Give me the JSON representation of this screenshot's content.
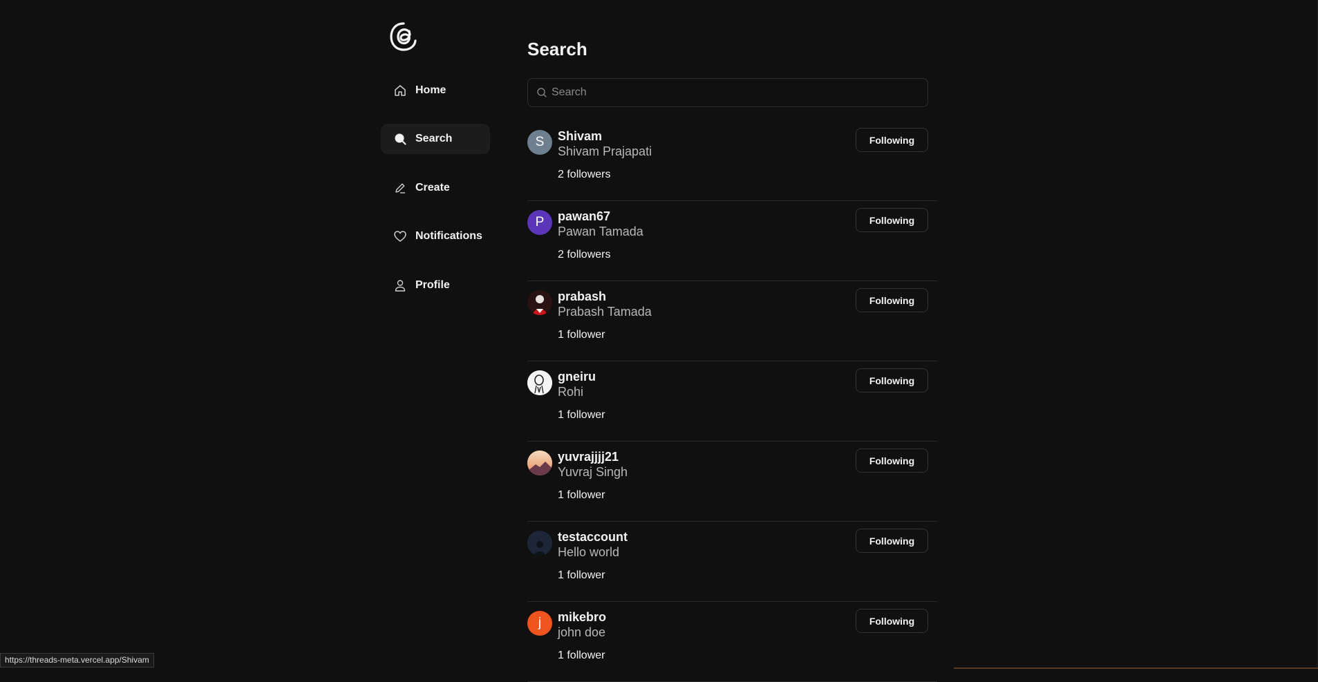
{
  "status_bar": {
    "url": "https://threads-meta.vercel.app/Shivam"
  },
  "sidebar": {
    "logo_icon": "threads-logo",
    "items": [
      {
        "label": "Home",
        "icon": "home-icon",
        "active": false
      },
      {
        "label": "Search",
        "icon": "search-icon",
        "active": true
      },
      {
        "label": "Create",
        "icon": "pencil-icon",
        "active": false
      },
      {
        "label": "Notifications",
        "icon": "heart-icon",
        "active": false
      },
      {
        "label": "Profile",
        "icon": "user-icon",
        "active": false
      }
    ]
  },
  "main": {
    "title": "Search",
    "search": {
      "placeholder": "Search",
      "value": ""
    },
    "users": [
      {
        "username": "Shivam",
        "name": "Shivam Prajapati",
        "followers": "2 followers",
        "button": "Following",
        "avatar_letter": "S",
        "avatar_color": "#6e7f8f"
      },
      {
        "username": "pawan67",
        "name": "Pawan Tamada",
        "followers": "2 followers",
        "button": "Following",
        "avatar_letter": "P",
        "avatar_color": "#5b36b8"
      },
      {
        "username": "prabash",
        "name": "Prabash Tamada",
        "followers": "1 follower",
        "button": "Following",
        "avatar_letter": "",
        "avatar_color": "#2a1212"
      },
      {
        "username": "gneiru",
        "name": "Rohi",
        "followers": "1 follower",
        "button": "Following",
        "avatar_letter": "",
        "avatar_color": "#f2f2f2"
      },
      {
        "username": "yuvrajjjj21",
        "name": "Yuvraj Singh",
        "followers": "1 follower",
        "button": "Following",
        "avatar_letter": "",
        "avatar_color": "#e8a878"
      },
      {
        "username": "testaccount",
        "name": "Hello world",
        "followers": "1 follower",
        "button": "Following",
        "avatar_letter": "",
        "avatar_color": "#1c2636"
      },
      {
        "username": "mikebro",
        "name": "john doe",
        "followers": "1 follower",
        "button": "Following",
        "avatar_letter": "j",
        "avatar_color": "#f0541e"
      }
    ]
  }
}
